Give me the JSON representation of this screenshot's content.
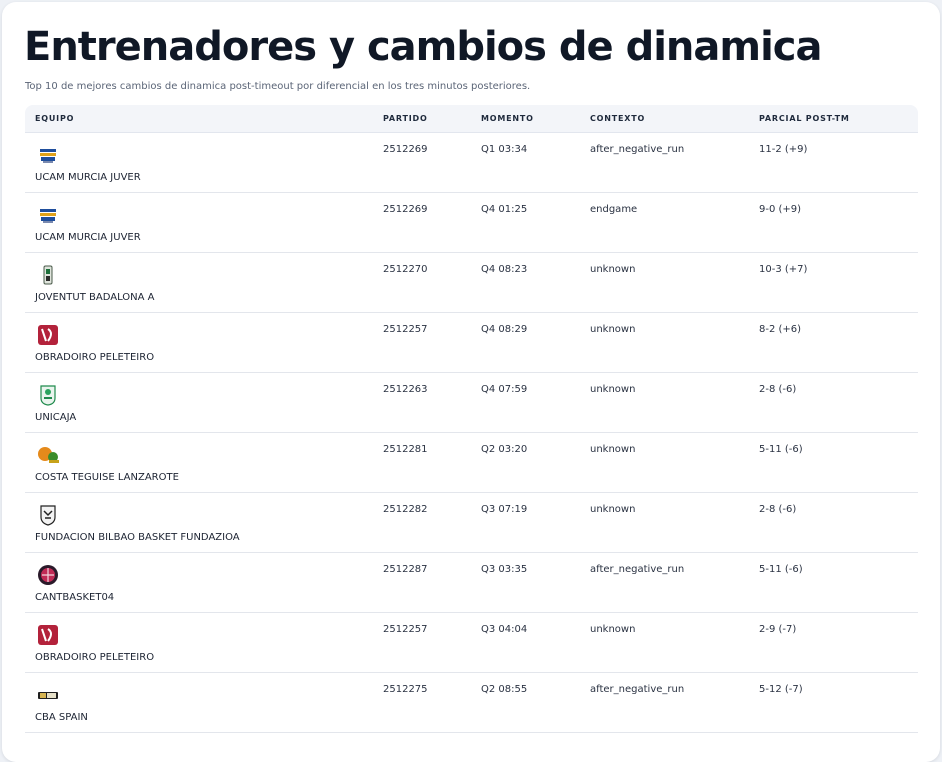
{
  "page": {
    "title": "Entrenadores y cambios de dinamica",
    "subtitle": "Top 10 de mejores cambios de dinamica post-timeout por diferencial en los tres minutos posteriores."
  },
  "table": {
    "headers": {
      "equipo": "EQUIPO",
      "partido": "PARTIDO",
      "momento": "MOMENTO",
      "contexto": "CONTEXTO",
      "parcial": "PARCIAL POST-TM"
    },
    "rows": [
      {
        "team": "UCAM MURCIA JUVER",
        "logo": "ucam-logo",
        "partido": "2512269",
        "momento": "Q1 03:34",
        "contexto": "after_negative_run",
        "parcial": "11-2 (+9)"
      },
      {
        "team": "UCAM MURCIA JUVER",
        "logo": "ucam-logo",
        "partido": "2512269",
        "momento": "Q4 01:25",
        "contexto": "endgame",
        "parcial": "9-0 (+9)"
      },
      {
        "team": "JOVENTUT BADALONA A",
        "logo": "joventut-logo",
        "partido": "2512270",
        "momento": "Q4 08:23",
        "contexto": "unknown",
        "parcial": "10-3 (+7)"
      },
      {
        "team": "OBRADOIRO PELETEIRO",
        "logo": "obradoiro-logo",
        "partido": "2512257",
        "momento": "Q4 08:29",
        "contexto": "unknown",
        "parcial": "8-2 (+6)"
      },
      {
        "team": "UNICAJA",
        "logo": "unicaja-logo",
        "partido": "2512263",
        "momento": "Q4 07:59",
        "contexto": "unknown",
        "parcial": "2-8 (-6)"
      },
      {
        "team": "COSTA TEGUISE LANZAROTE",
        "logo": "lanzarote-logo",
        "partido": "2512281",
        "momento": "Q2 03:20",
        "contexto": "unknown",
        "parcial": "5-11 (-6)"
      },
      {
        "team": "FUNDACION BILBAO BASKET FUNDAZIOA",
        "logo": "bilbao-logo",
        "partido": "2512282",
        "momento": "Q3 07:19",
        "contexto": "unknown",
        "parcial": "2-8 (-6)"
      },
      {
        "team": "CANTBASKET04",
        "logo": "cantbasket-logo",
        "partido": "2512287",
        "momento": "Q3 03:35",
        "contexto": "after_negative_run",
        "parcial": "5-11 (-6)"
      },
      {
        "team": "OBRADOIRO PELETEIRO",
        "logo": "obradoiro-logo",
        "partido": "2512257",
        "momento": "Q3 04:04",
        "contexto": "unknown",
        "parcial": "2-9 (-7)"
      },
      {
        "team": "CBA SPAIN",
        "logo": "cba-logo",
        "partido": "2512275",
        "momento": "Q2 08:55",
        "contexto": "after_negative_run",
        "parcial": "5-12 (-7)"
      }
    ]
  }
}
